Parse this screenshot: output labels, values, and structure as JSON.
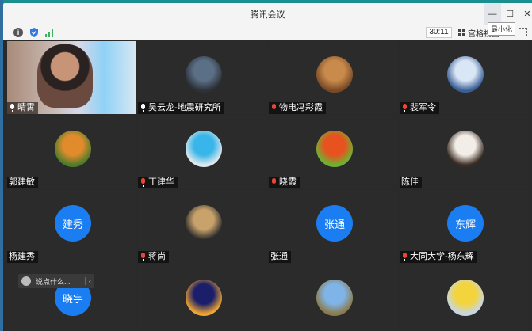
{
  "window": {
    "title": "腾讯会议"
  },
  "window_controls": {
    "minimize_tooltip": "最小化"
  },
  "toolbar": {
    "timer": "30:11",
    "layout_label": "宫格视图"
  },
  "participants": [
    {
      "name": "晴霄",
      "mic": "on",
      "kind": "video"
    },
    {
      "name": "吴云龙-地震研究所",
      "mic": "on",
      "kind": "photo",
      "avatar_colors": [
        "#5b6f86",
        "#2d3138"
      ]
    },
    {
      "name": "物电冯彩霞",
      "mic": "muted",
      "kind": "photo",
      "avatar_colors": [
        "#c98b4c",
        "#7a4a26"
      ]
    },
    {
      "name": "裴军令",
      "mic": "muted",
      "kind": "photo",
      "avatar_colors": [
        "#d9e6f6",
        "#3b5f95"
      ]
    },
    {
      "name": "郭建敏",
      "mic": "none",
      "kind": "photo",
      "avatar_colors": [
        "#e28b2c",
        "#4d7b2a"
      ]
    },
    {
      "name": "丁建华",
      "mic": "muted",
      "kind": "photo",
      "avatar_colors": [
        "#39b6e9",
        "#dfe9ee"
      ]
    },
    {
      "name": "晓霞",
      "mic": "muted",
      "kind": "photo",
      "avatar_colors": [
        "#e8521e",
        "#6fb233"
      ]
    },
    {
      "name": "陈佳",
      "mic": "none",
      "kind": "photo",
      "avatar_colors": [
        "#f2ede6",
        "#3b2c24"
      ]
    },
    {
      "name": "杨建秀",
      "mic": "none",
      "kind": "text",
      "initials": "建秀"
    },
    {
      "name": "蒋尚",
      "mic": "muted",
      "kind": "photo",
      "avatar_colors": [
        "#c8a16b",
        "#2b2b2b"
      ]
    },
    {
      "name": "张通",
      "mic": "none",
      "kind": "text",
      "initials": "张通"
    },
    {
      "name": "大同大学-杨东辉",
      "mic": "muted",
      "kind": "text",
      "initials": "东辉"
    },
    {
      "name": "",
      "mic": "none",
      "kind": "text",
      "initials": "晓宇"
    },
    {
      "name": "",
      "mic": "none",
      "kind": "photo",
      "avatar_colors": [
        "#1b1f6b",
        "#f0a630"
      ]
    },
    {
      "name": "",
      "mic": "none",
      "kind": "photo",
      "avatar_colors": [
        "#7fb4e8",
        "#8b7a4a"
      ]
    },
    {
      "name": "",
      "mic": "none",
      "kind": "photo",
      "avatar_colors": [
        "#f3d43c",
        "#c7d6e6"
      ]
    }
  ],
  "chat": {
    "placeholder": "说点什么..."
  }
}
